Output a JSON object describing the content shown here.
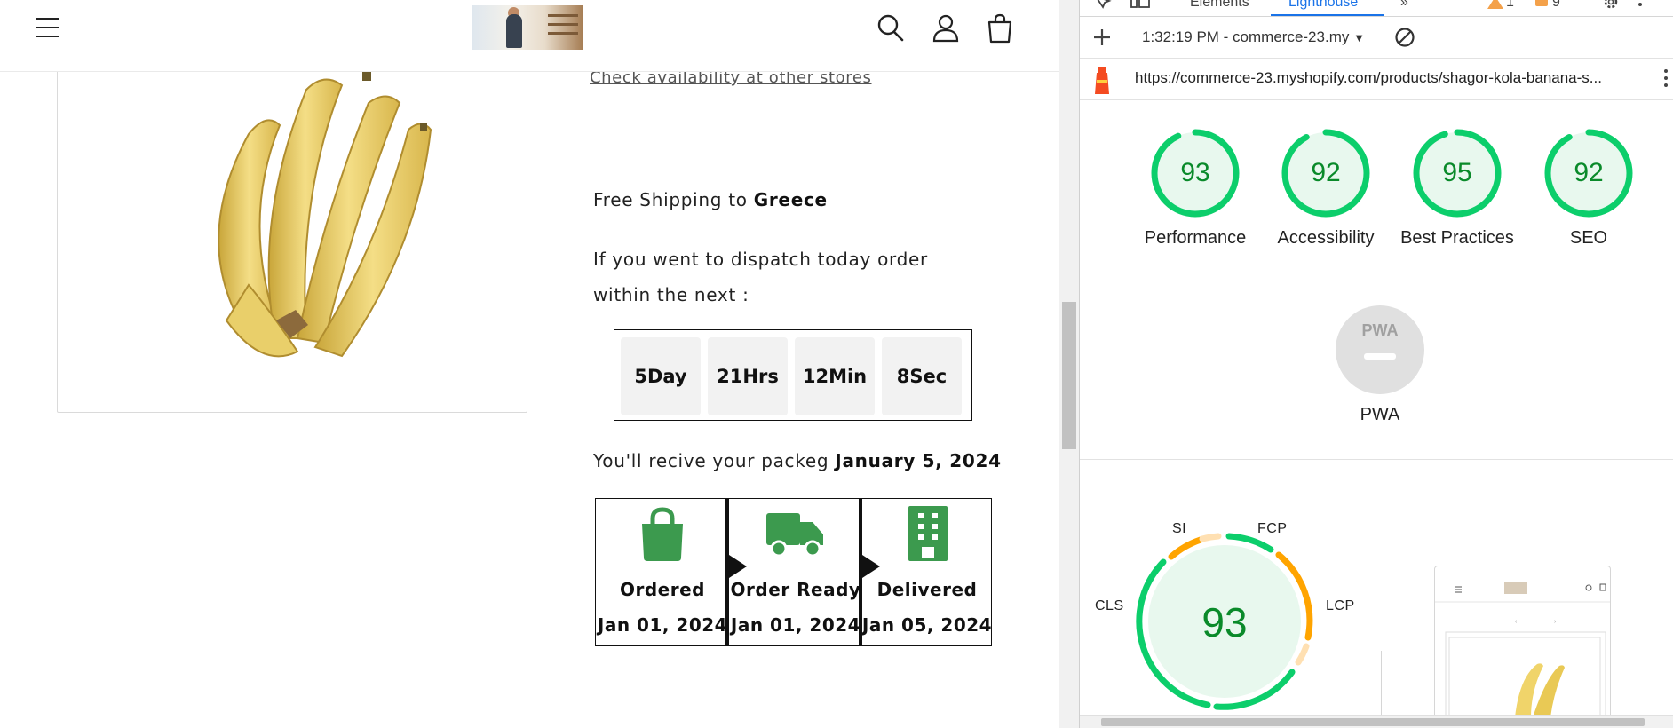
{
  "store": {
    "check_availability_link": "Check availability at other stores",
    "shipping_prefix": "Free Shipping to ",
    "shipping_country": "Greece",
    "dispatch_text": "If you went to dispatch today order within the next :",
    "countdown": [
      {
        "label": "5Day"
      },
      {
        "label": "21Hrs"
      },
      {
        "label": "12Min"
      },
      {
        "label": "8Sec"
      }
    ],
    "receive_prefix": "You'll recive your packeg ",
    "receive_date": "January 5, 2024",
    "stages": [
      {
        "label": "Ordered",
        "date": "Jan 01, 2024",
        "icon": "shopping-bag-icon"
      },
      {
        "label": "Order Ready",
        "date": "Jan 01, 2024",
        "icon": "truck-icon"
      },
      {
        "label": "Delivered",
        "date": "Jan 05, 2024",
        "icon": "building-icon"
      }
    ],
    "accent_green": "#3c9a4e"
  },
  "devtools": {
    "tabs": [
      "Elements",
      "Lighthouse"
    ],
    "active_tab": "Lighthouse",
    "warning_count": "1",
    "issue_count": "9",
    "report_time": "1:32:19 PM - commerce-23.my",
    "url": "https://commerce-23.myshopify.com/products/shagor-kola-banana-s...",
    "scores": [
      {
        "value": 93,
        "title": "Performance"
      },
      {
        "value": 92,
        "title": "Accessibility"
      },
      {
        "value": 95,
        "title": "Best Practices"
      },
      {
        "value": 92,
        "title": "SEO"
      }
    ],
    "pwa": {
      "badge": "PWA",
      "title": "PWA"
    },
    "performance_gauge": {
      "score": "93",
      "metrics": [
        "SI",
        "FCP",
        "CLS",
        "LCP"
      ]
    },
    "colors": {
      "pass": "#0cce6b",
      "average": "#ffa400",
      "text_pass": "#0a8a2a"
    }
  }
}
